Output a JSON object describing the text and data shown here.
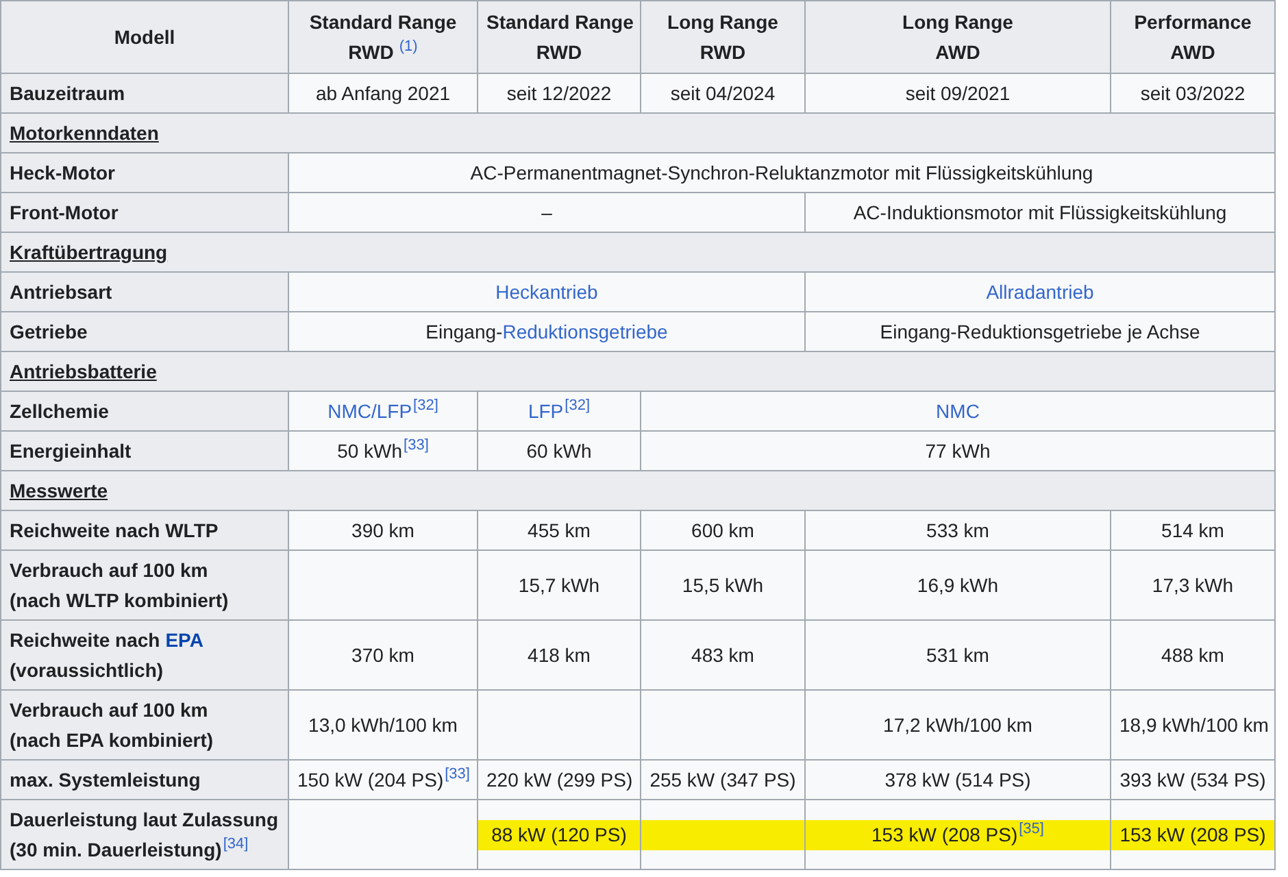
{
  "table": {
    "header": [
      {
        "parts": [
          {
            "kind": "text",
            "text": "Modell"
          }
        ]
      },
      {
        "parts": [
          {
            "kind": "text",
            "text": "Standard Range"
          },
          {
            "kind": "break"
          },
          {
            "kind": "text",
            "text": "RWD"
          },
          {
            "kind": "ref",
            "text": "(1)"
          }
        ]
      },
      {
        "parts": [
          {
            "kind": "text",
            "text": "Standard Range"
          },
          {
            "kind": "break"
          },
          {
            "kind": "text",
            "text": "RWD"
          }
        ]
      },
      {
        "parts": [
          {
            "kind": "text",
            "text": "Long Range"
          },
          {
            "kind": "break"
          },
          {
            "kind": "text",
            "text": "RWD"
          }
        ]
      },
      {
        "parts": [
          {
            "kind": "text",
            "text": "Long Range"
          },
          {
            "kind": "break"
          },
          {
            "kind": "text",
            "text": "AWD"
          }
        ]
      },
      {
        "parts": [
          {
            "kind": "text",
            "text": "Performance"
          },
          {
            "kind": "break"
          },
          {
            "kind": "text",
            "text": "AWD"
          }
        ]
      }
    ],
    "rows": [
      {
        "kind": "data",
        "label": [
          {
            "kind": "text",
            "text": "Bauzeitraum"
          }
        ],
        "cells": [
          {
            "kind": "value",
            "parts": [
              {
                "kind": "text",
                "text": "ab Anfang 2021"
              }
            ]
          },
          {
            "kind": "value",
            "parts": [
              {
                "kind": "text",
                "text": "seit 12/2022"
              }
            ]
          },
          {
            "kind": "value",
            "parts": [
              {
                "kind": "text",
                "text": "seit 04/2024"
              }
            ]
          },
          {
            "kind": "value",
            "parts": [
              {
                "kind": "text",
                "text": "seit 09/2021"
              }
            ]
          },
          {
            "kind": "value",
            "parts": [
              {
                "kind": "text",
                "text": "seit 03/2022"
              }
            ]
          }
        ]
      },
      {
        "kind": "section",
        "title": "Motorkenndaten"
      },
      {
        "kind": "data",
        "label": [
          {
            "kind": "text",
            "text": "Heck-Motor"
          }
        ],
        "cells": [
          {
            "kind": "value",
            "parts": [
              {
                "kind": "text",
                "text": "AC-Permanentmagnet-Synchron-Reluktanzmotor mit Flüssigkeitskühlung"
              }
            ]
          },
          {
            "kind": "continued"
          },
          {
            "kind": "continued"
          },
          {
            "kind": "continued"
          },
          {
            "kind": "continued"
          }
        ]
      },
      {
        "kind": "data",
        "label": [
          {
            "kind": "text",
            "text": "Front-Motor"
          }
        ],
        "cells": [
          {
            "kind": "value",
            "parts": [
              {
                "kind": "text",
                "text": "–"
              }
            ]
          },
          {
            "kind": "continued"
          },
          {
            "kind": "continued"
          },
          {
            "kind": "value",
            "parts": [
              {
                "kind": "text",
                "text": "AC-Induktionsmotor mit Flüssigkeitskühlung"
              }
            ]
          },
          {
            "kind": "continued"
          }
        ]
      },
      {
        "kind": "section",
        "title": "Kraftübertragung"
      },
      {
        "kind": "data",
        "label": [
          {
            "kind": "text",
            "text": "Antriebsart"
          }
        ],
        "cells": [
          {
            "kind": "value",
            "parts": [
              {
                "kind": "link",
                "text": "Heckantrieb"
              }
            ]
          },
          {
            "kind": "continued"
          },
          {
            "kind": "continued"
          },
          {
            "kind": "value",
            "parts": [
              {
                "kind": "link",
                "text": "Allradantrieb"
              }
            ]
          },
          {
            "kind": "continued"
          }
        ]
      },
      {
        "kind": "data",
        "label": [
          {
            "kind": "text",
            "text": "Getriebe"
          }
        ],
        "cells": [
          {
            "kind": "value",
            "parts": [
              {
                "kind": "text",
                "text": "Eingang-"
              },
              {
                "kind": "link",
                "text": "Reduktionsgetriebe"
              }
            ]
          },
          {
            "kind": "continued"
          },
          {
            "kind": "continued"
          },
          {
            "kind": "value",
            "parts": [
              {
                "kind": "text",
                "text": "Eingang-Reduktionsgetriebe je Achse"
              }
            ]
          },
          {
            "kind": "continued"
          }
        ]
      },
      {
        "kind": "section",
        "title": "Antriebsbatterie"
      },
      {
        "kind": "data",
        "label": [
          {
            "kind": "text",
            "text": "Zellchemie"
          }
        ],
        "cells": [
          {
            "kind": "value",
            "parts": [
              {
                "kind": "link",
                "text": "NMC/LFP"
              },
              {
                "kind": "ref",
                "text": "[32]"
              }
            ]
          },
          {
            "kind": "value",
            "parts": [
              {
                "kind": "link",
                "text": "LFP"
              },
              {
                "kind": "ref",
                "text": "[32]"
              }
            ]
          },
          {
            "kind": "value",
            "parts": [
              {
                "kind": "link",
                "text": "NMC"
              }
            ]
          },
          {
            "kind": "continued"
          },
          {
            "kind": "continued"
          }
        ]
      },
      {
        "kind": "data",
        "label": [
          {
            "kind": "text",
            "text": "Energieinhalt"
          }
        ],
        "cells": [
          {
            "kind": "value",
            "parts": [
              {
                "kind": "text",
                "text": "50 kWh"
              },
              {
                "kind": "ref",
                "text": "[33]"
              }
            ]
          },
          {
            "kind": "value",
            "parts": [
              {
                "kind": "text",
                "text": "60 kWh"
              }
            ]
          },
          {
            "kind": "value",
            "parts": [
              {
                "kind": "text",
                "text": "77 kWh"
              }
            ]
          },
          {
            "kind": "continued"
          },
          {
            "kind": "continued"
          }
        ]
      },
      {
        "kind": "section",
        "title": "Messwerte"
      },
      {
        "kind": "data",
        "label": [
          {
            "kind": "text",
            "text": "Reichweite nach WLTP"
          }
        ],
        "cells": [
          {
            "kind": "value",
            "parts": [
              {
                "kind": "text",
                "text": "390 km"
              }
            ]
          },
          {
            "kind": "value",
            "parts": [
              {
                "kind": "text",
                "text": "455 km"
              }
            ]
          },
          {
            "kind": "value",
            "parts": [
              {
                "kind": "text",
                "text": "600 km"
              }
            ]
          },
          {
            "kind": "value",
            "parts": [
              {
                "kind": "text",
                "text": "533 km"
              }
            ]
          },
          {
            "kind": "value",
            "parts": [
              {
                "kind": "text",
                "text": "514 km"
              }
            ]
          }
        ]
      },
      {
        "kind": "data",
        "label": [
          {
            "kind": "text",
            "text": "Verbrauch auf 100 km"
          },
          {
            "kind": "break"
          },
          {
            "kind": "text",
            "text": "(nach WLTP kombiniert)"
          }
        ],
        "cells": [
          {
            "kind": "empty"
          },
          {
            "kind": "value",
            "parts": [
              {
                "kind": "text",
                "text": "15,7 kWh"
              }
            ]
          },
          {
            "kind": "value",
            "parts": [
              {
                "kind": "text",
                "text": "15,5 kWh"
              }
            ]
          },
          {
            "kind": "value",
            "parts": [
              {
                "kind": "text",
                "text": "16,9 kWh"
              }
            ]
          },
          {
            "kind": "value",
            "parts": [
              {
                "kind": "text",
                "text": "17,3 kWh"
              }
            ]
          }
        ]
      },
      {
        "kind": "data",
        "label": [
          {
            "kind": "text",
            "text": "Reichweite nach"
          },
          {
            "kind": "link",
            "text": "EPA"
          },
          {
            "kind": "break"
          },
          {
            "kind": "text",
            "text": "(voraussichtlich)"
          }
        ],
        "cells": [
          {
            "kind": "value",
            "parts": [
              {
                "kind": "text",
                "text": "370 km"
              }
            ]
          },
          {
            "kind": "value",
            "parts": [
              {
                "kind": "text",
                "text": "418 km"
              }
            ]
          },
          {
            "kind": "value",
            "parts": [
              {
                "kind": "text",
                "text": "483 km"
              }
            ]
          },
          {
            "kind": "value",
            "parts": [
              {
                "kind": "text",
                "text": "531 km"
              }
            ]
          },
          {
            "kind": "value",
            "parts": [
              {
                "kind": "text",
                "text": "488 km"
              }
            ]
          }
        ]
      },
      {
        "kind": "data",
        "label": [
          {
            "kind": "text",
            "text": "Verbrauch auf 100 km"
          },
          {
            "kind": "break"
          },
          {
            "kind": "text",
            "text": "(nach EPA kombiniert)"
          }
        ],
        "cells": [
          {
            "kind": "value",
            "parts": [
              {
                "kind": "text",
                "text": "13,0 kWh/100 km"
              }
            ]
          },
          {
            "kind": "empty"
          },
          {
            "kind": "empty"
          },
          {
            "kind": "value",
            "parts": [
              {
                "kind": "text",
                "text": "17,2 kWh/100 km"
              }
            ]
          },
          {
            "kind": "value",
            "parts": [
              {
                "kind": "text",
                "text": "18,9 kWh/100 km"
              }
            ]
          }
        ]
      },
      {
        "kind": "data",
        "label": [
          {
            "kind": "text",
            "text": "max. Systemleistung"
          }
        ],
        "cells": [
          {
            "kind": "value",
            "parts": [
              {
                "kind": "text",
                "text": "150 kW (204 PS)"
              },
              {
                "kind": "ref",
                "text": "[33]"
              }
            ]
          },
          {
            "kind": "value",
            "parts": [
              {
                "kind": "text",
                "text": "220 kW (299 PS)"
              }
            ]
          },
          {
            "kind": "value",
            "parts": [
              {
                "kind": "text",
                "text": "255 kW (347 PS)"
              }
            ]
          },
          {
            "kind": "value",
            "parts": [
              {
                "kind": "text",
                "text": "378 kW (514 PS)"
              }
            ]
          },
          {
            "kind": "value",
            "parts": [
              {
                "kind": "text",
                "text": "393 kW (534 PS)"
              }
            ]
          }
        ]
      },
      {
        "kind": "data",
        "label": [
          {
            "kind": "text",
            "text": "Dauerleistung laut Zulassung"
          },
          {
            "kind": "break"
          },
          {
            "kind": "text",
            "text": "(30 min. Dauerleistung)"
          },
          {
            "kind": "ref",
            "text": "[34]"
          }
        ],
        "cells": [
          {
            "kind": "empty",
            "highlight": false
          },
          {
            "kind": "value",
            "highlight": true,
            "parts": [
              {
                "kind": "text",
                "text": "88 kW (120 PS)"
              }
            ]
          },
          {
            "kind": "empty",
            "highlight": true
          },
          {
            "kind": "value",
            "highlight": true,
            "parts": [
              {
                "kind": "text",
                "text": "153 kW (208 PS)"
              },
              {
                "kind": "ref",
                "text": "[35]"
              }
            ]
          },
          {
            "kind": "value",
            "highlight": true,
            "parts": [
              {
                "kind": "text",
                "text": "153 kW (208 PS)"
              }
            ]
          }
        ]
      }
    ]
  }
}
